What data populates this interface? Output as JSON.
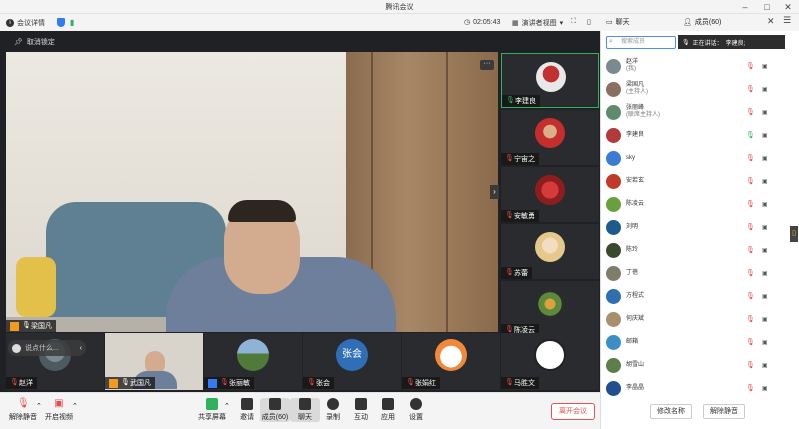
{
  "window": {
    "title": "腾讯会议"
  },
  "toprow": {
    "meeting_info": "会议详情",
    "timer": "02:05:43",
    "view_mode": "演讲者视图"
  },
  "stage": {
    "unpin": "取消锁定",
    "main_name": "梁国凡",
    "chat_placeholder": "说点什么...",
    "right_tiles": [
      "李建良",
      "宁宙之",
      "安敏勇",
      "苏蕾",
      "陈凌云"
    ],
    "bottom_tiles": [
      "赵洋",
      "武国凡",
      "张丽敏",
      "张会",
      "张娟红",
      "马胜文"
    ],
    "zhanghui_avatar": "张会"
  },
  "toolbar": {
    "mute": "解除静音",
    "video": "开启视频",
    "share": "共享屏幕",
    "invite": "邀请",
    "members": "成员(60)",
    "chat": "聊天",
    "record": "录制",
    "interact": "互动",
    "apps": "应用",
    "settings": "设置",
    "leave": "离开会议"
  },
  "panel": {
    "tab_chat": "聊天",
    "tab_members": "成员(60)",
    "search_placeholder": "搜索成员",
    "speaking_label": "正在讲话：",
    "speaking_name": "李建良;",
    "rename": "修改名称",
    "unmute_all": "解除静音",
    "members": [
      {
        "name": "赵洋",
        "role": "(我)",
        "color": "#7a8a8f",
        "mic": "off"
      },
      {
        "name": "梁国凡",
        "role": "(主持人)",
        "color": "#8a7060",
        "mic": "off"
      },
      {
        "name": "张丽峰",
        "role": "(联席主持人)",
        "color": "#5e8a6e",
        "mic": "off"
      },
      {
        "name": "李建良",
        "role": "",
        "color": "#b23a3a",
        "mic": "on"
      },
      {
        "name": "sky",
        "role": "",
        "color": "#3a7bd5",
        "mic": "off"
      },
      {
        "name": "安若玄",
        "role": "",
        "color": "#c0392b",
        "mic": "off"
      },
      {
        "name": "陈凌云",
        "role": "",
        "color": "#6a9f3e",
        "mic": "off"
      },
      {
        "name": "刘明",
        "role": "",
        "color": "#1d5c8a",
        "mic": "off"
      },
      {
        "name": "陈玲",
        "role": "",
        "color": "#3b4a2e",
        "mic": "off"
      },
      {
        "name": "丁蓓",
        "role": "",
        "color": "#7d7d6a",
        "mic": "off"
      },
      {
        "name": "方程式",
        "role": "",
        "color": "#2f6fb0",
        "mic": "off"
      },
      {
        "name": "何庆斌",
        "role": "",
        "color": "#aa8f6d",
        "mic": "off"
      },
      {
        "name": "邮箱",
        "role": "",
        "color": "#3c8fc6",
        "mic": "off"
      },
      {
        "name": "胡雪山",
        "role": "",
        "color": "#5d7d4a",
        "mic": "off"
      },
      {
        "name": "李晶晶",
        "role": "",
        "color": "#1f4f8f",
        "mic": "off"
      }
    ]
  }
}
